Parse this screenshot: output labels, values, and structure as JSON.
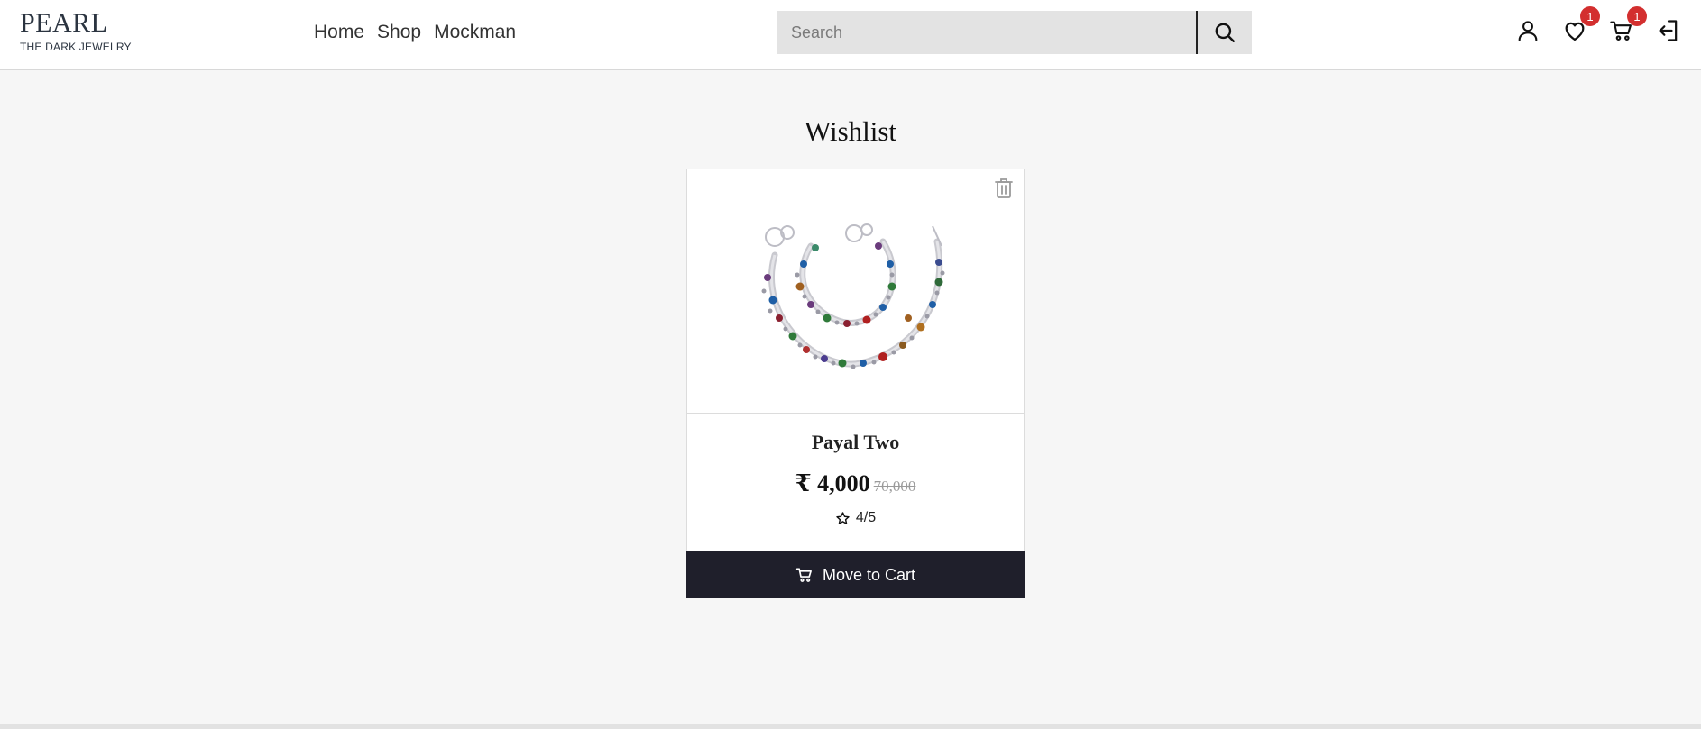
{
  "brand": {
    "name": "PEARL",
    "tagline": "THE DARK JEWELRY"
  },
  "nav": {
    "home": "Home",
    "shop": "Shop",
    "mockman": "Mockman"
  },
  "search": {
    "placeholder": "Search",
    "icon": "search-icon"
  },
  "header_icons": {
    "profile": "user-icon",
    "wishlist": {
      "icon": "heart-icon",
      "count": "1"
    },
    "cart": {
      "icon": "cart-icon",
      "count": "1"
    },
    "logout": "logout-icon"
  },
  "page": {
    "title": "Wishlist"
  },
  "wishlist_items": [
    {
      "name": "Payal Two",
      "price": "₹ 4,000",
      "old_price": "70,000",
      "rating": "4/5",
      "image_icon": "anklet-image",
      "delete_icon": "trash-icon",
      "action_label": "Move to Cart",
      "action_icon": "cart-icon"
    }
  ],
  "colors": {
    "background": "#f6f6f6",
    "header": "#ffffff",
    "button_dark": "#1f1f2b",
    "badge": "#d32f2f",
    "search_bg": "#e3e3e3"
  }
}
